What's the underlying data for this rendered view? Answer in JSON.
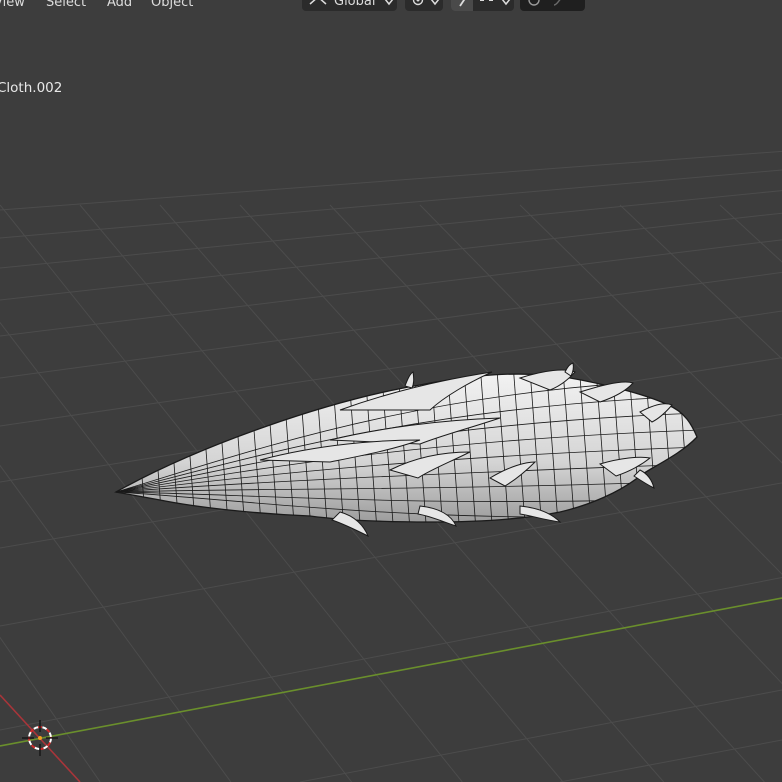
{
  "header": {
    "menu": [
      {
        "label": "View"
      },
      {
        "label": "Select"
      },
      {
        "label": "Add"
      },
      {
        "label": "Object"
      }
    ],
    "orientation": {
      "label": "Global"
    }
  },
  "viewport": {
    "object_label": "Cloth.002",
    "colors": {
      "background": "#3d3d3d",
      "grid_line": "#4c4c4c",
      "x_axis": "#a8353a",
      "y_axis": "#6a8f2c",
      "mesh_fill": "#d6d6d6",
      "mesh_wire": "#1a1a1a"
    }
  }
}
